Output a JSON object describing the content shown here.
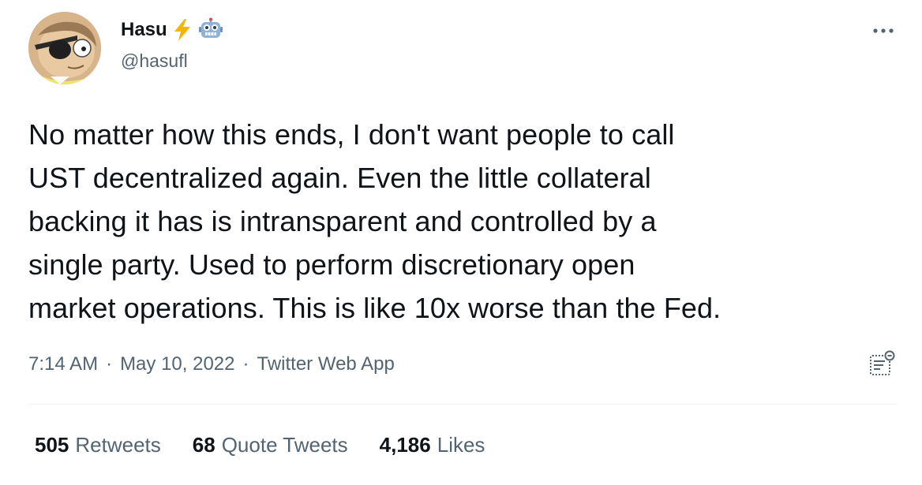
{
  "author": {
    "display_name": "Hasu",
    "handle": "@hasufl",
    "badges": [
      "lightning-bolt-emoji",
      "robot-emoji"
    ]
  },
  "tweet": {
    "text": "No matter how this ends, I don't want people to call\nUST decentralized again. Even the little collateral\nbacking it has is intransparent and controlled by a\nsingle party. Used to perform discretionary open\nmarket operations. This is like 10x worse than the Fed."
  },
  "meta": {
    "time": "7:14 AM",
    "separator": "·",
    "date": "May 10, 2022",
    "source": "Twitter Web App"
  },
  "stats": {
    "retweets_count": "505",
    "retweets_label": "Retweets",
    "quotes_count": "68",
    "quotes_label": "Quote Tweets",
    "likes_count": "4,186",
    "likes_label": "Likes"
  },
  "icons": {
    "more": "more-horizontal-icon",
    "analytics": "analytics-icon"
  },
  "colors": {
    "text_primary": "#0f1419",
    "text_secondary": "#536471",
    "divider": "#eff3f4",
    "lightning": "#f4b400",
    "robot": "#5b8cc9"
  }
}
